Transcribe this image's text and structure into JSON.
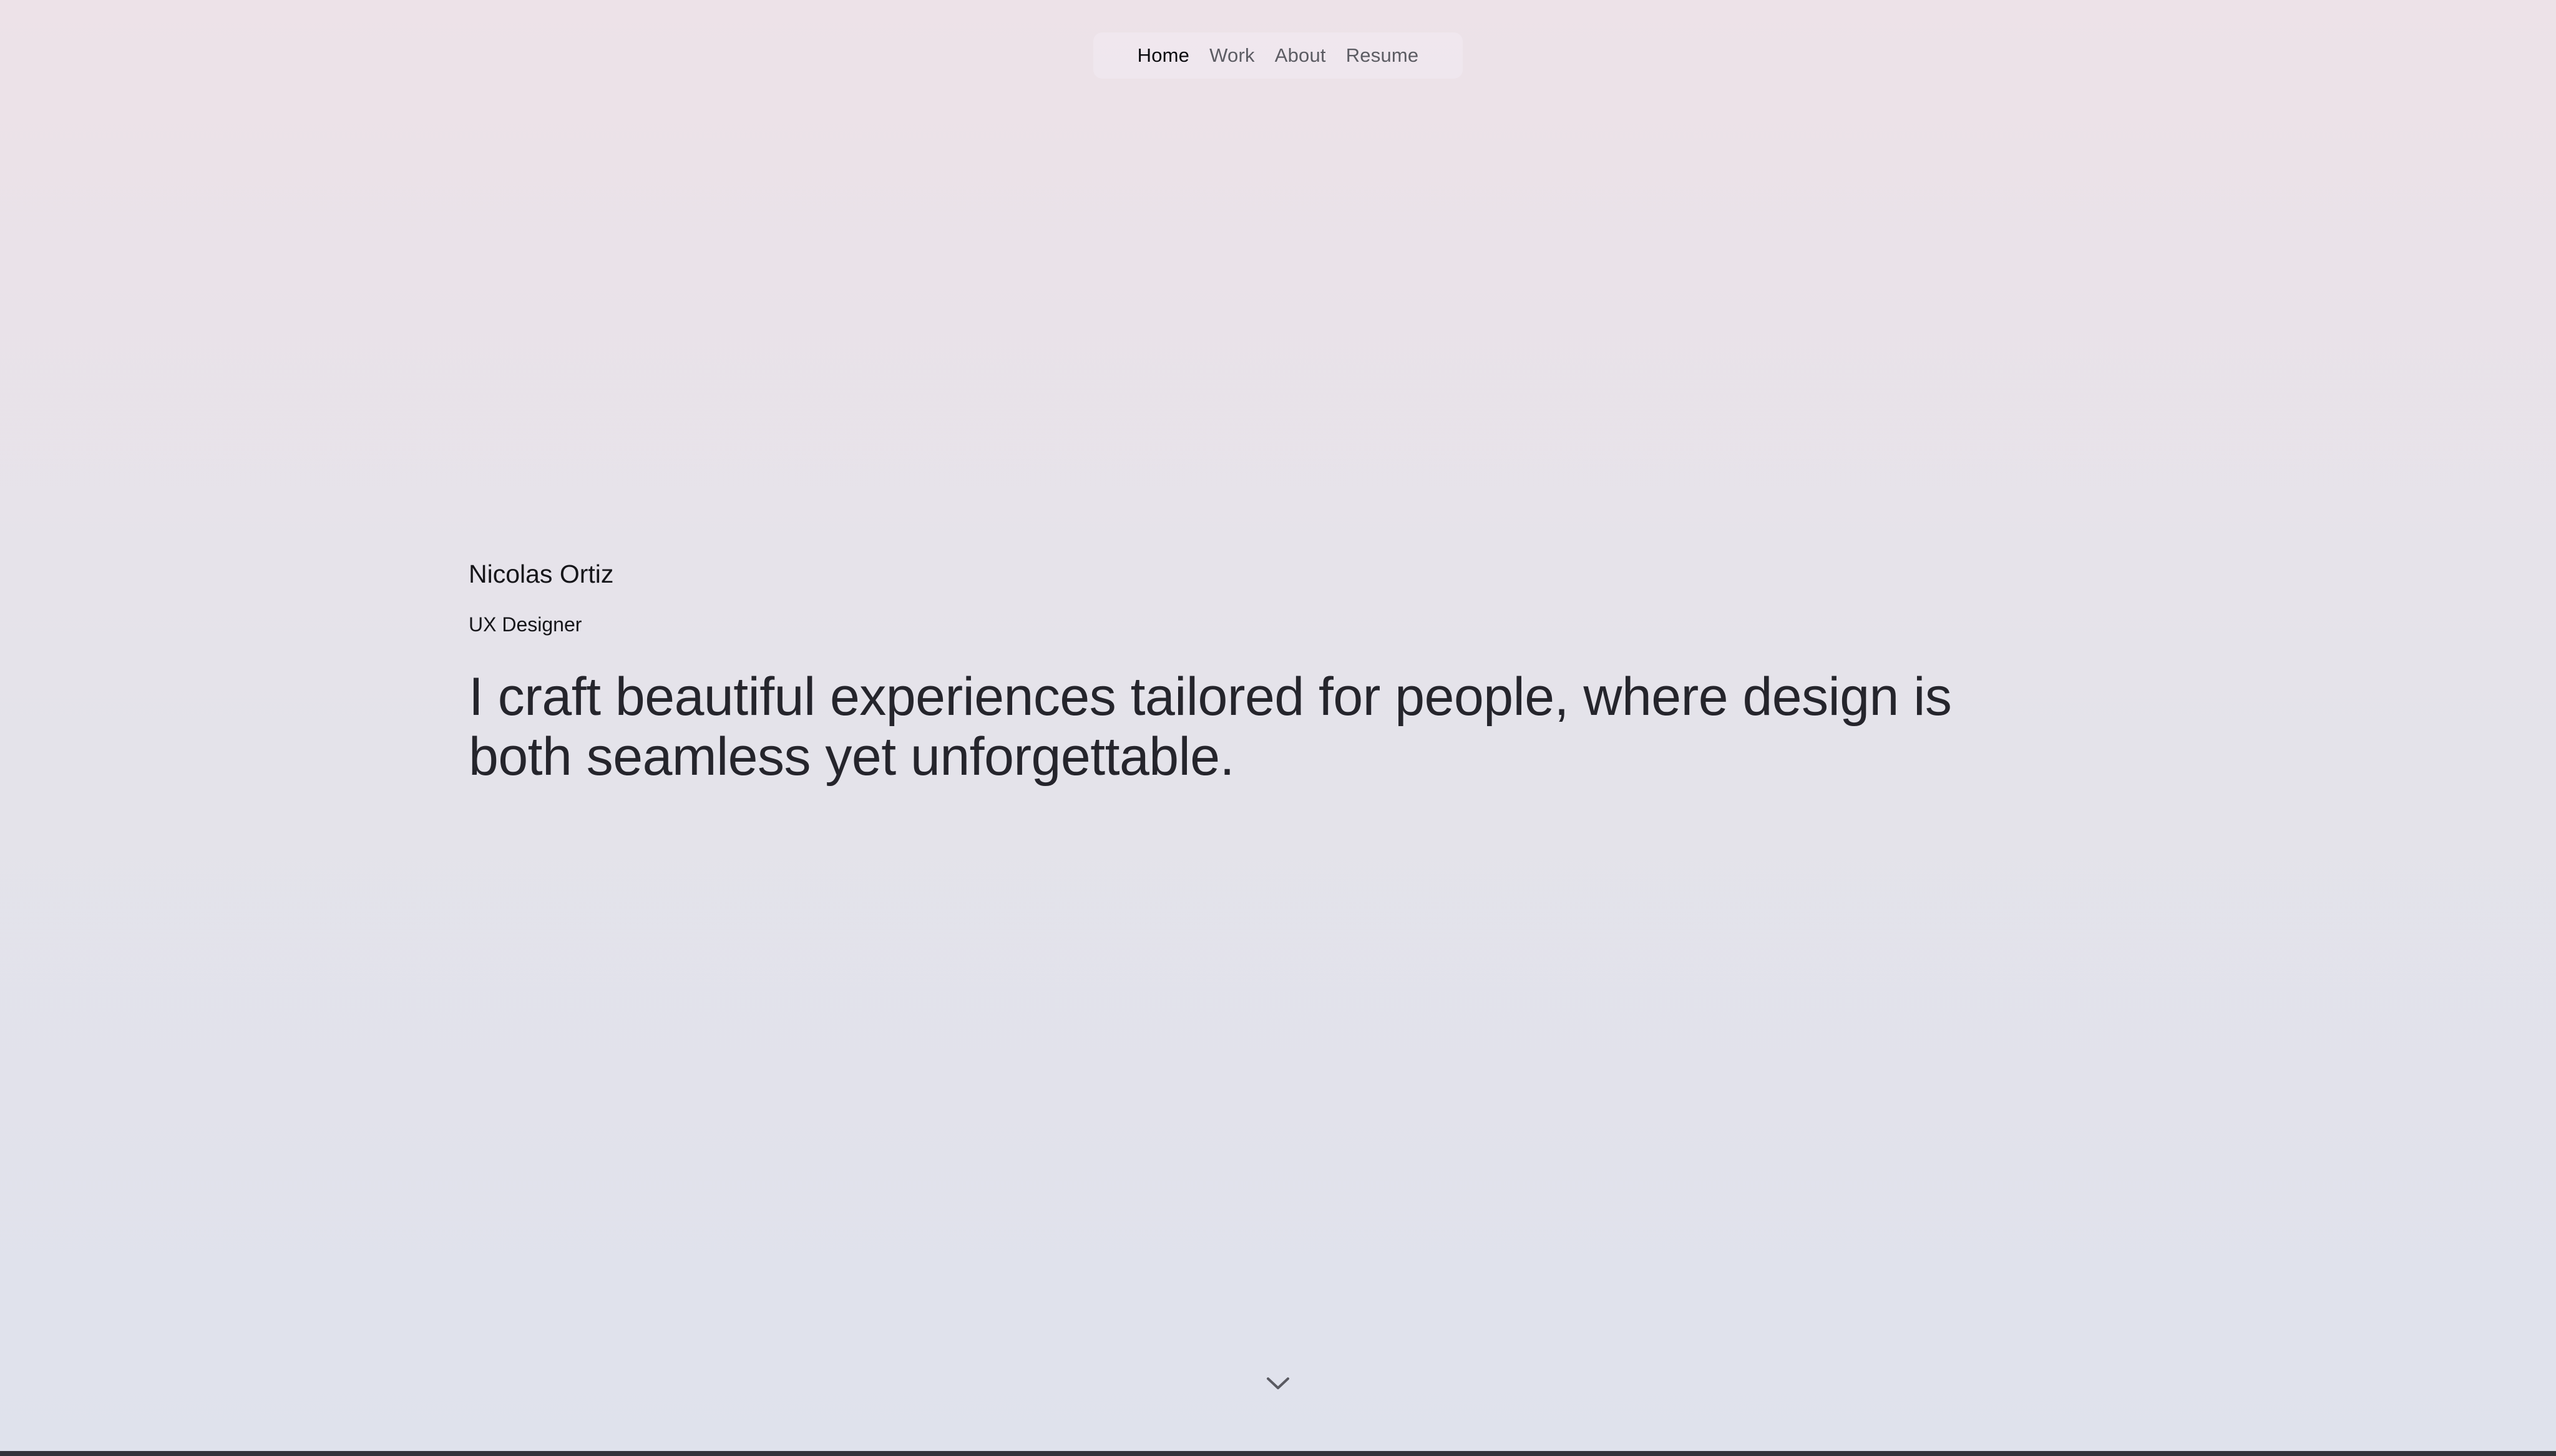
{
  "nav": {
    "items": [
      {
        "label": "Home",
        "active": true
      },
      {
        "label": "Work",
        "active": false
      },
      {
        "label": "About",
        "active": false
      },
      {
        "label": "Resume",
        "active": false
      }
    ]
  },
  "hero": {
    "name": "Nicolas Ortiz",
    "role": "UX Designer",
    "tagline": "I craft beautiful experiences tailored for people, where design is both seamless yet unforgettable."
  },
  "scroll": {
    "icon": "chevron-down-icon"
  },
  "colors": {
    "background_top": "#ede2e8",
    "background_bottom": "#dfe2ec",
    "text_primary": "#24242b",
    "nav_inactive": "#5c5c63",
    "nav_active": "#0b0b0f"
  }
}
